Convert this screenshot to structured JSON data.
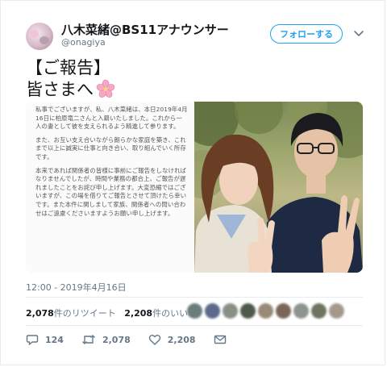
{
  "tweet": {
    "display_name": "八木菜緒@BS11アナウンサー",
    "handle": "@onagiya",
    "follow_label": "フォローする",
    "title_line1": "【ご報告】",
    "title_line2": "皆さまへ",
    "timestamp": "12:00 - 2019年4月16日",
    "retweets_count": "2,078",
    "retweets_label": "件のリツイート",
    "likes_count": "2,208",
    "likes_label": "件のいいね",
    "reply_count": "124",
    "retweet_action_count": "2,078",
    "like_action_count": "2,208"
  },
  "media_text": {
    "p1": "私事でございますが、私、八木菜緒は、本日2019年4月16日に柏原竜二さんと入籍いたしました。これから一人の妻として彼を支えられるよう精進して参ります。",
    "p2": "また、お互い支え合いながら朗らかな家庭を築き、これまで以上に誠実に仕事と向き合い、取り組んでいく所存です。",
    "p3": "本来であれば関係者の皆様に事前にご報告をしなければなりませんでしたが、時間や業務の都合上、ご報告が遅れましたことをお詫び申し上げます。大変恐縮ではございますが、この場を借りてご報告とさせて頂けたら幸いです。また本件に関しまして家族、関係者への問い合わせはご遠慮くださいますようお願い申し上げます。"
  },
  "colors": {
    "accent": "#1da1f2",
    "text_primary": "#14171a",
    "text_secondary": "#657786"
  },
  "icons": [
    "chevron-down-icon",
    "cherry-blossom-icon",
    "reply-icon",
    "retweet-icon",
    "heart-icon"
  ]
}
